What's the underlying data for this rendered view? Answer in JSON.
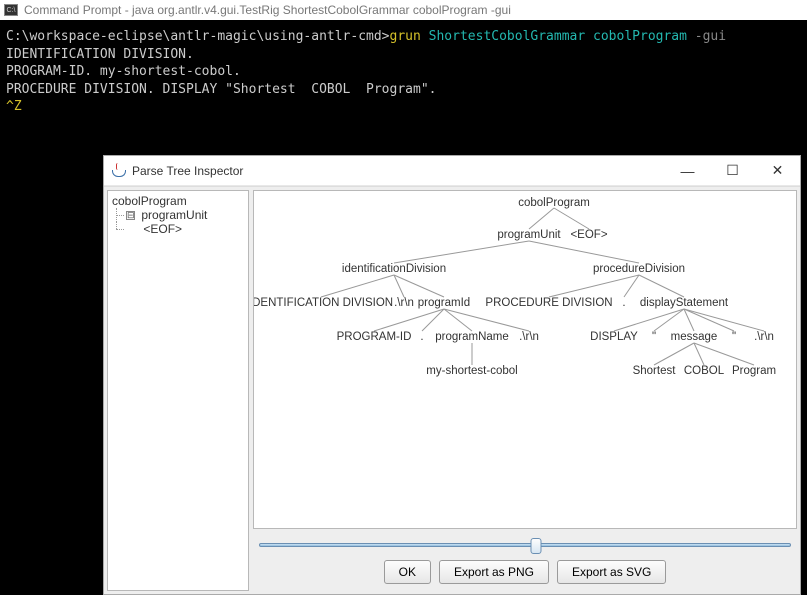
{
  "cmd": {
    "title": "Command Prompt - java  org.antlr.v4.gui.TestRig ShortestCobolGrammar cobolProgram -gui",
    "icon_label": "C:\\",
    "prompt": "C:\\workspace-eclipse\\antlr-magic\\using-antlr-cmd>",
    "command": "grun",
    "arg1": "ShortestCobolGrammar",
    "arg2": "cobolProgram",
    "flag": "-gui",
    "lines": [
      "IDENTIFICATION DIVISION.",
      "PROGRAM-ID. my-shortest-cobol.",
      "PROCEDURE DIVISION. DISPLAY \"Shortest  COBOL  Program\"."
    ],
    "ctrl": "^Z"
  },
  "inspector": {
    "title": "Parse Tree Inspector",
    "win_min": "—",
    "win_max": "☐",
    "win_close": "✕",
    "tree_panel": {
      "root": "cobolProgram",
      "toggle": "⊟",
      "children": [
        "programUnit",
        "<EOF>"
      ]
    },
    "buttons": {
      "ok": "OK",
      "png": "Export as PNG",
      "svg": "Export as SVG"
    },
    "parse_tree": {
      "n0": "cobolProgram",
      "n1": "programUnit",
      "n2": "<EOF>",
      "n3": "identificationDivision",
      "n4": "procedureDivision",
      "n5": "IDENTIFICATION DIVISION",
      "n6": ".\\r\\n",
      "n7": "programId",
      "n8": "PROCEDURE DIVISION",
      "n9": ".",
      "n10": "displayStatement",
      "n11": "PROGRAM-ID",
      "n12": ".",
      "n13": "programName",
      "n14": ".\\r\\n",
      "n15": "DISPLAY",
      "n16": "\"",
      "n17": "message",
      "n18": "\"",
      "n19": ".\\r\\n",
      "n20": "my-shortest-cobol",
      "n21": "Shortest",
      "n22": "COBOL",
      "n23": "Program"
    }
  }
}
